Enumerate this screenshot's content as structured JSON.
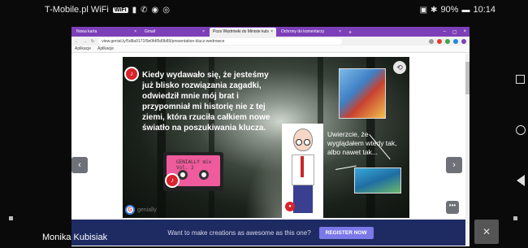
{
  "status_bar": {
    "carrier": "T-Mobile.pl WiFi",
    "wifi_badge": "WiFi",
    "battery": "90%",
    "time": "10:14"
  },
  "browser": {
    "tabs": [
      {
        "label": "Nowa karta",
        "active": false
      },
      {
        "label": "Gmail",
        "active": false
      },
      {
        "label": "Pozs Wędrówki do Ministe kuls",
        "active": true
      },
      {
        "label": "Ochrony do komentarzy",
        "active": false
      }
    ],
    "url": "view.genial.ly/5d8a9171f9e0fdf5d9b89/presentation-klucz-wedrowce",
    "bookmarks": [
      "Aplikacje",
      "Aplikacje"
    ]
  },
  "slide": {
    "main_text": "Kiedy wydawało się, że jesteśmy już blisko rozwiązania zagadki, odwiedził mnie mój brat i przypomniał mi historię nie z tej ziemi, która rzuciła całkiem nowe światło na poszukiwania klucza.",
    "speech_text": "Uwierzcie, że wyglądałem wtedy tak, albo nawet tak...",
    "cassette_label": "GENIALLY mix Vol. 2",
    "logo_text": "genially"
  },
  "cta": {
    "message": "Want to make creations as awesome as this one?",
    "button": "REGISTER NOW"
  },
  "meeting": {
    "participant_name": "Monika Kubisiak"
  },
  "icons": {
    "sound": "sound-icon",
    "share": "share-icon",
    "prev": "chevron-left-icon",
    "next": "chevron-right-icon",
    "mic_off": "mic-off-icon"
  },
  "colors": {
    "tab_bar": "#7c3fb8",
    "cta_bar": "#1e2b63",
    "cta_button": "#7b78e8",
    "accent_red": "#d9232b"
  }
}
